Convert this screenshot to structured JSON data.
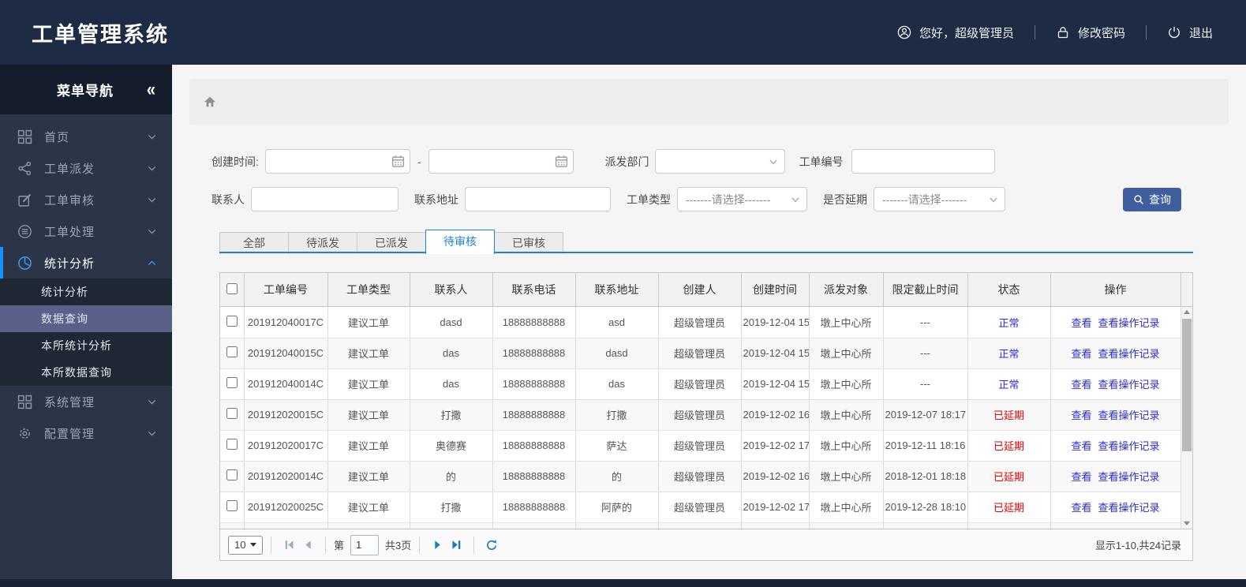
{
  "app": {
    "title": "工单管理系统"
  },
  "user_bar": {
    "greeting": "您好，超级管理员",
    "change_password": "修改密码",
    "logout": "退出"
  },
  "sidebar": {
    "title": "菜单导航",
    "collapse_glyph": "«",
    "items": [
      {
        "label": "首页",
        "icon": "grid"
      },
      {
        "label": "工单派发",
        "icon": "share"
      },
      {
        "label": "工单审核",
        "icon": "edit"
      },
      {
        "label": "工单处理",
        "icon": "process"
      },
      {
        "label": "统计分析",
        "icon": "pie",
        "active": true,
        "children": [
          "统计分析",
          "数据查询",
          "本所统计分析",
          "本所数据查询"
        ],
        "selected_child": "数据查询"
      },
      {
        "label": "系统管理",
        "icon": "grid"
      },
      {
        "label": "配置管理",
        "icon": "gear"
      }
    ]
  },
  "filters": {
    "created_label": "创建时间:",
    "date_from_value": "",
    "date_separator": "-",
    "date_to_value": "",
    "dept_label": "派发部门",
    "dept_value": "",
    "order_no_label": "工单编号",
    "order_no_value": "",
    "contact_label": "联系人",
    "contact_value": "",
    "address_label": "联系地址",
    "address_value": "",
    "type_label": "工单类型",
    "type_value": "-------请选择-------",
    "delay_label": "是否延期",
    "delay_value": "-------请选择-------",
    "search_button": "查询"
  },
  "tabs": [
    {
      "label": "全部",
      "active": false
    },
    {
      "label": "待派发",
      "active": false
    },
    {
      "label": "已派发",
      "active": false
    },
    {
      "label": "待审核",
      "active": true
    },
    {
      "label": "已审核",
      "active": false
    }
  ],
  "table": {
    "headers": [
      "工单编号",
      "工单类型",
      "联系人",
      "联系电话",
      "联系地址",
      "创建人",
      "创建时间",
      "派发对象",
      "限定截止时间",
      "状态",
      "操作"
    ],
    "action_links": [
      "查看",
      "查看操作记录"
    ],
    "rows": [
      {
        "order_no": "201912040017C",
        "type": "建议工单",
        "contact": "dasd",
        "phone": "18888888888",
        "address": "asd",
        "creator": "超级管理员",
        "created": "2019-12-04 15",
        "target": "墩上中心所",
        "deadline": "---",
        "status": "正常",
        "status_type": "normal"
      },
      {
        "order_no": "201912040015C",
        "type": "建议工单",
        "contact": "das",
        "phone": "18888888888",
        "address": "dasd",
        "creator": "超级管理员",
        "created": "2019-12-04 15",
        "target": "墩上中心所",
        "deadline": "---",
        "status": "正常",
        "status_type": "normal"
      },
      {
        "order_no": "201912040014C",
        "type": "建议工单",
        "contact": "das",
        "phone": "18888888888",
        "address": "das",
        "creator": "超级管理员",
        "created": "2019-12-04 15",
        "target": "墩上中心所",
        "deadline": "---",
        "status": "正常",
        "status_type": "normal"
      },
      {
        "order_no": "201912020015C",
        "type": "建议工单",
        "contact": "打撒",
        "phone": "18888888888",
        "address": "打撒",
        "creator": "超级管理员",
        "created": "2019-12-02 16",
        "target": "墩上中心所",
        "deadline": "2019-12-07 18:17",
        "status": "已延期",
        "status_type": "delayed"
      },
      {
        "order_no": "201912020017C",
        "type": "建议工单",
        "contact": "奥德赛",
        "phone": "18888888888",
        "address": "萨达",
        "creator": "超级管理员",
        "created": "2019-12-02 17",
        "target": "墩上中心所",
        "deadline": "2019-12-11 18:16",
        "status": "已延期",
        "status_type": "delayed"
      },
      {
        "order_no": "201912020014C",
        "type": "建议工单",
        "contact": "的",
        "phone": "18888888888",
        "address": "的",
        "creator": "超级管理员",
        "created": "2019-12-02 16",
        "target": "墩上中心所",
        "deadline": "2018-12-01 18:18",
        "status": "已延期",
        "status_type": "delayed"
      },
      {
        "order_no": "201912020025C",
        "type": "建议工单",
        "contact": "打撒",
        "phone": "18888888888",
        "address": "阿萨的",
        "creator": "超级管理员",
        "created": "2019-12-02 17",
        "target": "墩上中心所",
        "deadline": "2019-12-28 18:10",
        "status": "已延期",
        "status_type": "delayed"
      }
    ],
    "partial_row_visible": true
  },
  "pagination": {
    "page_size": "10",
    "page_prefix": "第",
    "current_page": "1",
    "total_pages": "共3页",
    "record_info": "显示1-10,共24记录"
  },
  "icons": {
    "user": "person-in-circle",
    "lock": "padlock",
    "logout": "power-symbol",
    "collapse": "double-chevron-left",
    "home": "house",
    "calendar": "calendar-grid",
    "search": "magnifier",
    "select_arrow": "chevron-down",
    "pager": [
      "first-page",
      "prev-page",
      "next-page",
      "last-page",
      "refresh"
    ]
  },
  "colors": {
    "header_bg": "#1e2b45",
    "sidebar_bg": "#2b3547",
    "active_indicator": "#1890ff",
    "selected_submenu": "#5a6189",
    "tab_accent": "#1e84d0",
    "search_button": "#3f5e9d",
    "link_blue": "#2b2bd2",
    "status_normal": "#2b2bd2",
    "status_delayed": "#e60000"
  }
}
